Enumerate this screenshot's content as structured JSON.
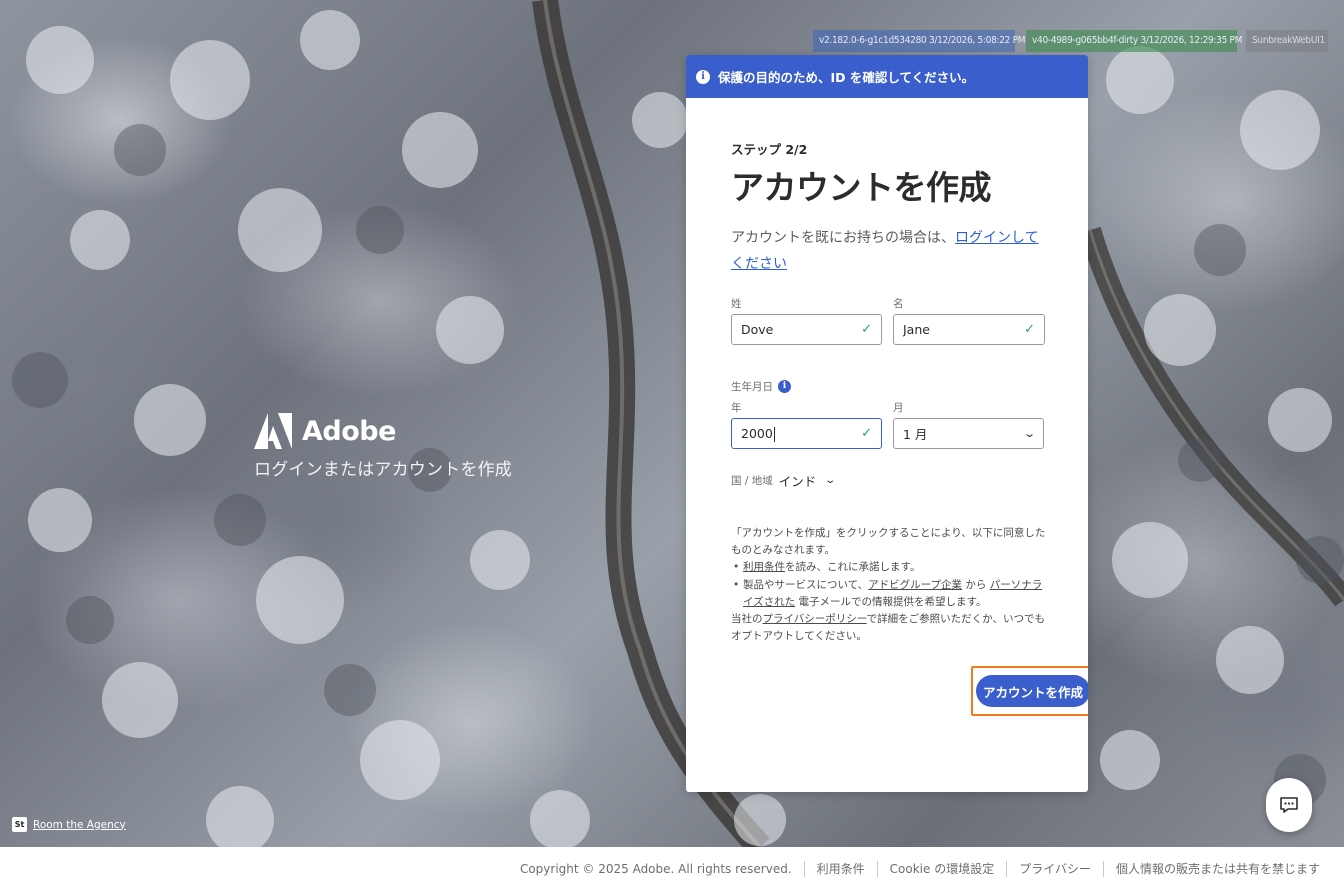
{
  "build_badges": [
    "v2.182.0-6-g1c1d534280 3/12/2026, 5:08:22 PM",
    "v40-4989-g065bb4f-dirty 3/12/2026, 12:29:35 PM",
    "SunbreakWebUI1"
  ],
  "brand": {
    "name": "Adobe",
    "tagline": "ログインまたはアカウントを作成"
  },
  "banner": {
    "icon": "info-icon",
    "text": "保護の目的のため、ID を確認してください。"
  },
  "form": {
    "step": "ステップ 2/2",
    "title": "アカウントを作成",
    "signin_prefix": "アカウントを既にお持ちの場合は、",
    "signin_link": "ログインしてください",
    "last_name": {
      "label": "姓",
      "value": "Dove"
    },
    "first_name": {
      "label": "名",
      "value": "Jane"
    },
    "dob_label": "生年月日",
    "year": {
      "label": "年",
      "value": "2000"
    },
    "month": {
      "label": "月",
      "value": "1 月"
    },
    "country": {
      "label": "国 / 地域",
      "value": "インド"
    },
    "legal": {
      "intro": "「アカウントを作成」をクリックすることにより、以下に同意したものとみなされます。",
      "item1_link": "利用条件",
      "item1_suffix": "を読み、これに承諾します。",
      "item2_prefix": "製品やサービスについて、",
      "item2_link1": "アドビグループ企業",
      "item2_mid": " から ",
      "item2_link2": "パーソナライズされた",
      "item2_suffix": " 電子メールでの情報提供を希望します。",
      "outro_prefix": "当社の",
      "outro_link": "プライバシーポリシー",
      "outro_suffix": "で詳細をご参照いただくか、いつでもオプトアウトしてください。"
    },
    "submit_label": "アカウントを作成"
  },
  "agency": {
    "badge": "St",
    "name": "Room the Agency"
  },
  "footer": {
    "copyright": "Copyright © 2025 Adobe. All rights reserved.",
    "links": [
      "利用条件",
      "Cookie の環境設定",
      "プライバシー",
      "個人情報の販売または共有を禁じます"
    ]
  },
  "colors": {
    "accent": "#3a5fcd",
    "focus_outline": "#f07c1a",
    "valid_check": "#2d9d5e"
  }
}
